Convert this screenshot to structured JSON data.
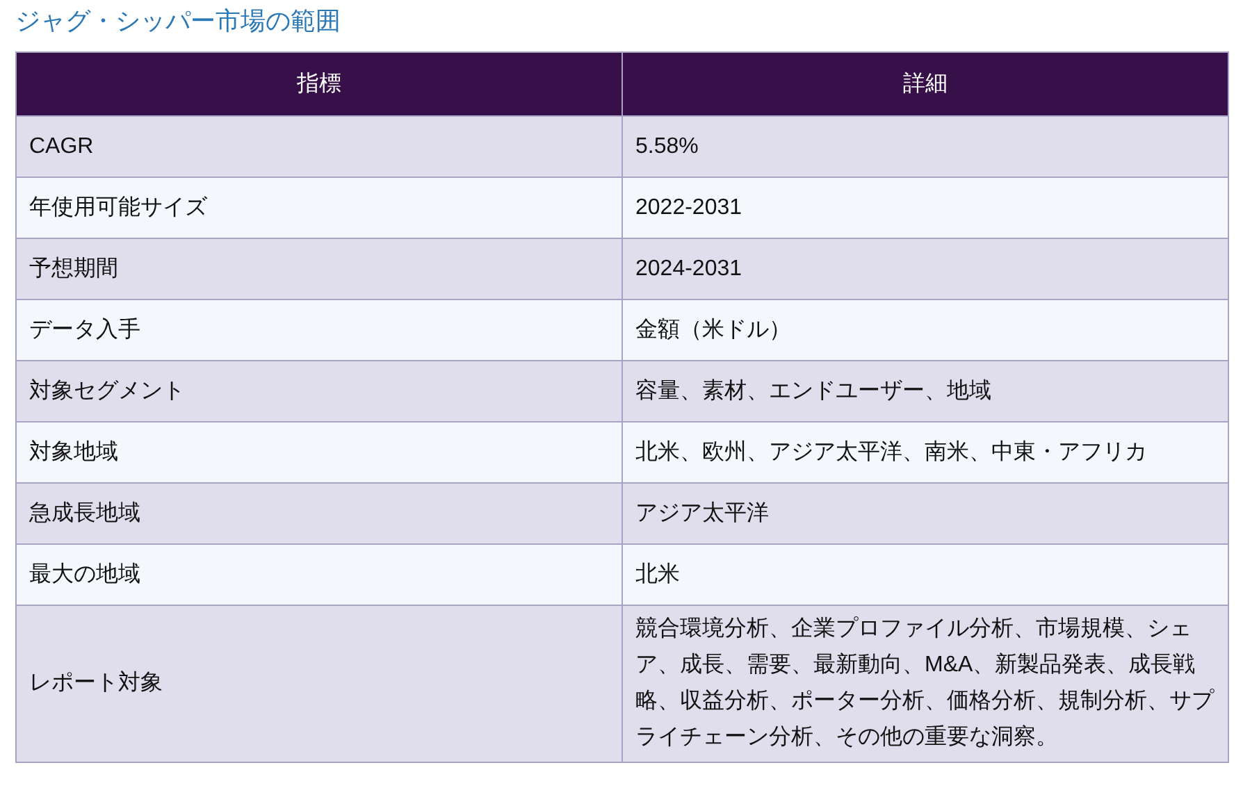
{
  "title": "ジャグ・シッパー市場の範囲",
  "table": {
    "columns": [
      "指標",
      "詳細"
    ],
    "rows": [
      [
        "CAGR",
        "5.58%"
      ],
      [
        "年使用可能サイズ",
        "2022-2031"
      ],
      [
        "予想期間",
        "2024-2031"
      ],
      [
        "データ入手",
        "金額（米ドル）"
      ],
      [
        "対象セグメント",
        "容量、素材、エンドユーザー、地域"
      ],
      [
        "対象地域",
        "北米、欧州、アジア太平洋、南米、中東・アフリカ"
      ],
      [
        "急成長地域",
        "アジア太平洋"
      ],
      [
        "最大の地域",
        "北米"
      ],
      [
        "レポート対象",
        "競合環境分析、企業プロファイル分析、市場規模、シェア、成長、需要、最新動向、M&A、新製品発表、成長戦略、収益分析、ポーター分析、価格分析、規制分析、サプライチェーン分析、その他の重要な洞察。"
      ]
    ]
  }
}
